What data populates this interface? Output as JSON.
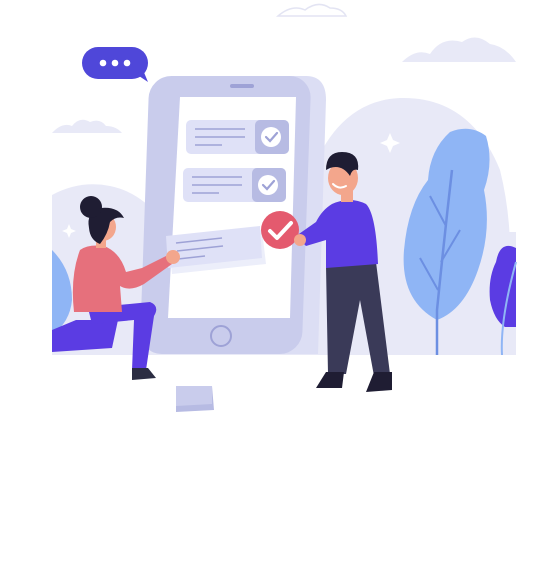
{
  "illustration": {
    "subject": "phone-checklist-people",
    "icons": [
      "chat-bubble-icon",
      "check-icon",
      "sparkle-icon",
      "leaf-icon"
    ],
    "checklist_items": [
      {
        "state": "checked"
      },
      {
        "state": "checked"
      }
    ],
    "colors": {
      "background": "#ffffff",
      "blob": "#e8e9f7",
      "phone_frame": "#c9ccec",
      "phone_screen": "#ffffff",
      "card": "#dfe1f7",
      "check_badge": "#b7bbe3",
      "accent_red": "#e45a6e",
      "purple": "#5b3ce3",
      "blue_leaf": "#8fb5f5",
      "dark": "#2b2d42",
      "pink_shirt": "#e6707c"
    }
  }
}
